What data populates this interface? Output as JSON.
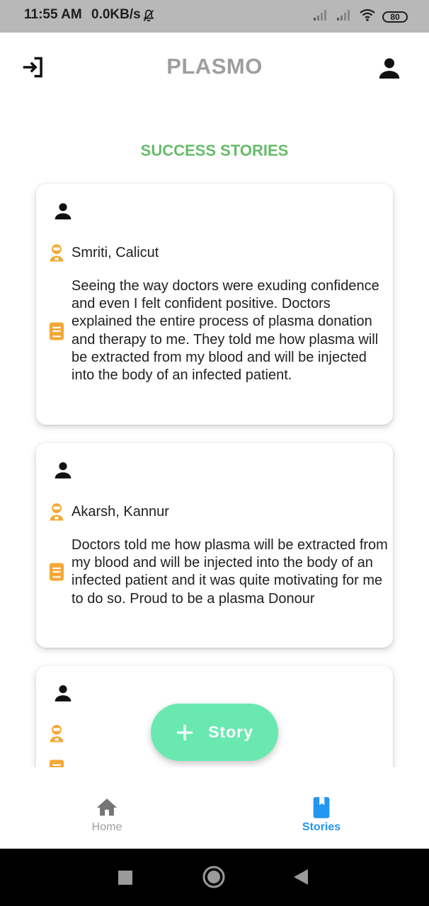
{
  "status_bar": {
    "time": "11:55 AM",
    "network_speed": "0.0KB/s",
    "battery": "80",
    "icons": [
      "bell-muted-icon",
      "signal-icon",
      "signal-icon",
      "wifi-icon",
      "battery-icon"
    ]
  },
  "app_bar": {
    "title": "PLASMO",
    "left_icon": "logout-icon",
    "right_icon": "profile-icon"
  },
  "heading": "SUCCESS STORIES",
  "stories": [
    {
      "name": "Smriti, Calicut",
      "story": "Seeing the way doctors were exuding confidence and even I felt confident positive. Doctors explained the entire process of plasma donation and therapy to me. They told me how plasma will be extracted from my blood and will be injected into the body of an infected patient."
    },
    {
      "name": "Akarsh, Kannur",
      "story": "Doctors told me how plasma will be extracted from my blood and will be injected into the body of an infected patient and it was quite motivating for me to do so. Proud to be a plasma Donour"
    },
    {
      "name": "",
      "story": ""
    }
  ],
  "fab": {
    "label": "Story",
    "icon": "plus-icon"
  },
  "bottom_nav": {
    "items": [
      {
        "label": "Home",
        "icon": "home-icon",
        "active": false
      },
      {
        "label": "Stories",
        "icon": "book-icon",
        "active": true
      }
    ]
  },
  "colors": {
    "heading": "#66bb6a",
    "title": "#9e9e9e",
    "accent_orange": "#f4a836",
    "fab": "#69e9b0",
    "nav_active": "#2196f3",
    "nav_inactive": "#9e9e9e"
  }
}
